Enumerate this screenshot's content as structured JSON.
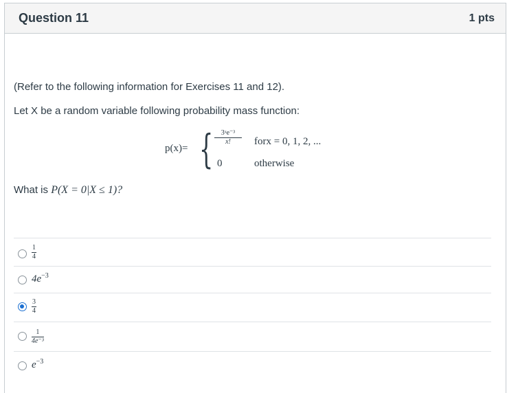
{
  "question": {
    "title": "Question 11",
    "points": "1 pts",
    "intro": "(Refer to the following information for Exercises 11 and 12).",
    "stem": "Let X be a random variable following probability mass function:",
    "formula": {
      "lhs": "p(x)=",
      "case1_num": "3ˣe⁻³",
      "case1_den": "x!",
      "case1_cond": "forx = 0, 1, 2, ...",
      "case2_value": "0",
      "case2_cond": "otherwise"
    },
    "prompt_text": "What is ",
    "prompt_math": "P(X = 0|X ≤ 1)?"
  },
  "answers": [
    {
      "num": "1",
      "den": "4",
      "selected": false
    },
    {
      "text": "4e",
      "sup": "−3",
      "selected": false
    },
    {
      "num": "3",
      "den": "4",
      "selected": true
    },
    {
      "num": "1",
      "den": "4e⁻³",
      "selected": false
    },
    {
      "text": "e",
      "sup": "−3",
      "selected": false
    }
  ]
}
